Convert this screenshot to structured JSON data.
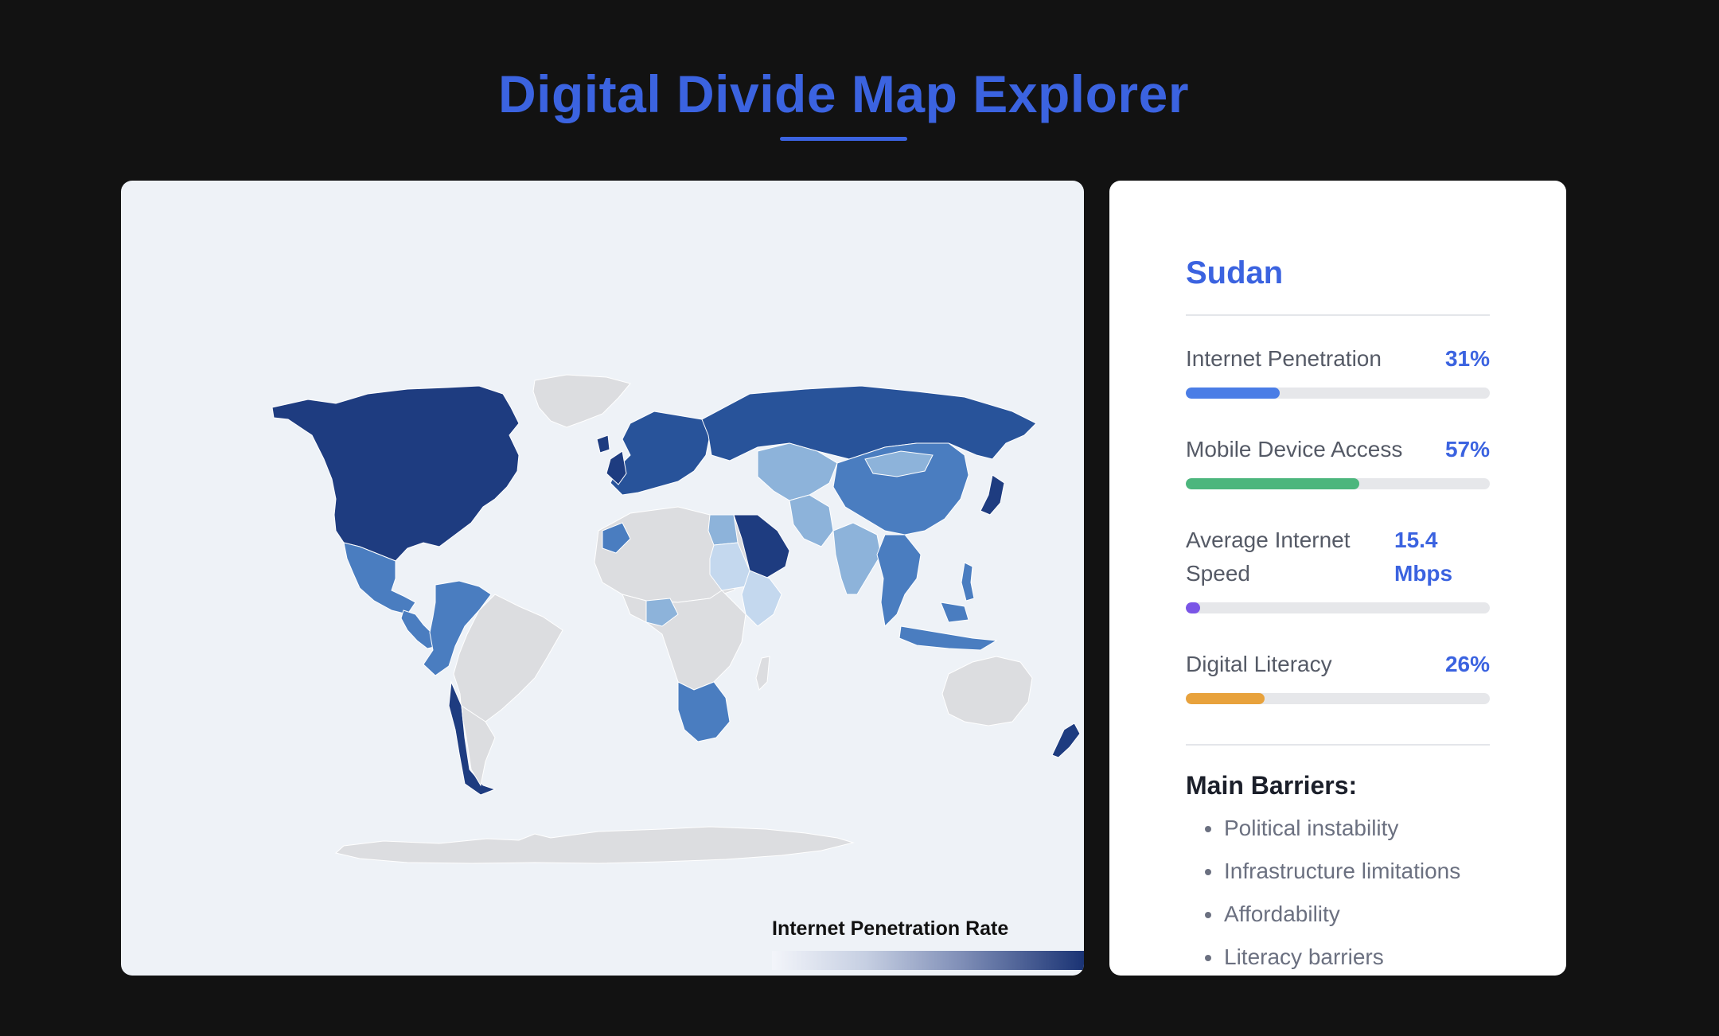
{
  "app": {
    "title": "Digital Divide Map Explorer"
  },
  "map": {
    "legend_title": "Internet Penetration Rate",
    "legend_colors": [
      "#f3f5fa",
      "#1a3374"
    ],
    "colors": {
      "no_data": "#dcdde0",
      "very_high": "#1e3c80",
      "high": "#28539a",
      "medium_high": "#4a7dc0",
      "medium": "#8db3da",
      "low": "#c4d8ee",
      "ocean": "#eef2f7"
    },
    "regions": [
      {
        "name": "North America",
        "level": "very_high"
      },
      {
        "name": "Greenland",
        "level": "no_data"
      },
      {
        "name": "Mexico",
        "level": "medium_high"
      },
      {
        "name": "Central America",
        "level": "medium_high"
      },
      {
        "name": "South America (west)",
        "level": "medium_high"
      },
      {
        "name": "Brazil",
        "level": "no_data"
      },
      {
        "name": "Chile",
        "level": "very_high"
      },
      {
        "name": "Europe",
        "level": "high"
      },
      {
        "name": "Russia",
        "level": "high"
      },
      {
        "name": "China",
        "level": "medium_high"
      },
      {
        "name": "India",
        "level": "medium"
      },
      {
        "name": "Saudi Arabia",
        "level": "very_high"
      },
      {
        "name": "North Africa",
        "level": "no_data"
      },
      {
        "name": "Sudan",
        "level": "low"
      },
      {
        "name": "Southern Africa",
        "level": "medium_high"
      },
      {
        "name": "Australia",
        "level": "no_data"
      },
      {
        "name": "Antarctica",
        "level": "no_data"
      },
      {
        "name": "Japan",
        "level": "very_high"
      },
      {
        "name": "Southeast Asia",
        "level": "medium_high"
      },
      {
        "name": "New Zealand",
        "level": "very_high"
      }
    ]
  },
  "details": {
    "country": "Sudan",
    "metrics": [
      {
        "label": "Internet Penetration",
        "value": "31%",
        "fraction": 0.31,
        "color": "#4a7de6"
      },
      {
        "label": "Mobile Device Access",
        "value": "57%",
        "fraction": 0.57,
        "color": "#4cb67d"
      },
      {
        "label": "Average Internet Speed",
        "value": "15.4 Mbps",
        "fraction": 0.04,
        "color": "#7a55e6"
      },
      {
        "label": "Digital Literacy",
        "value": "26%",
        "fraction": 0.26,
        "color": "#e8a23c"
      }
    ],
    "barriers_title": "Main Barriers:",
    "barriers": [
      "Political instability",
      "Infrastructure limitations",
      "Affordability",
      "Literacy barriers"
    ]
  }
}
